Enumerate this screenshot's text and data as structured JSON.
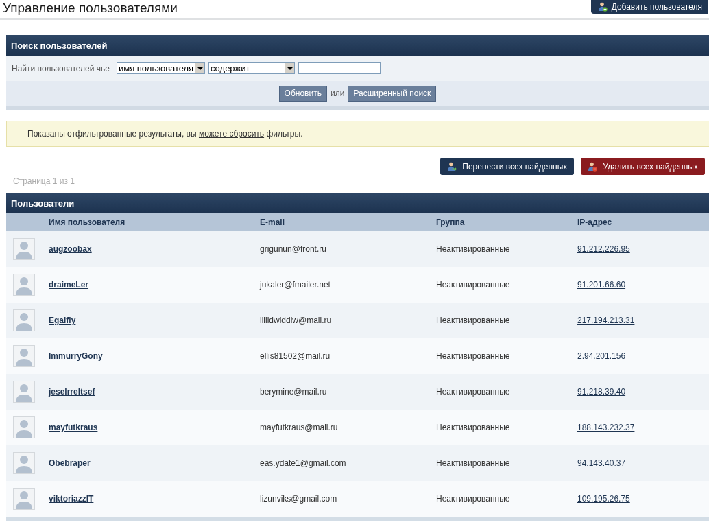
{
  "page_title": "Управление пользователями",
  "add_button": {
    "label": "Добавить пользователя"
  },
  "search_panel": {
    "title": "Поиск пользователей",
    "label": "Найти пользователей чье",
    "dropdowns": [
      {
        "value": "имя пользователя"
      },
      {
        "value": "содержит"
      }
    ],
    "update_button": "Обновить",
    "or_text": "или",
    "advanced_button": "Расширенный поиск"
  },
  "notice": {
    "text_before": "Показаны отфильтрованные результаты, вы ",
    "link": "можете сбросить",
    "text_after": " фильтры."
  },
  "action_buttons": [
    {
      "kind": "move",
      "label": "Перенести всех найденных"
    },
    {
      "kind": "delete",
      "label": "Удалить всех найденных"
    }
  ],
  "pagination": "Страница 1 из 1",
  "users_panel": {
    "title": "Пользователи",
    "columns": [
      "Имя пользователя",
      "E-mail",
      "Группа",
      "IP-адрес"
    ],
    "rows": [
      {
        "username": "augzoobax",
        "email": "grigunun@front.ru",
        "group": "Неактивированные",
        "ip": "91.212.226.95"
      },
      {
        "username": "draimeLer",
        "email": "jukaler@fmailer.net",
        "group": "Неактивированные",
        "ip": "91.201.66.60"
      },
      {
        "username": "Egalfly",
        "email": "iiiiidwiddiw@mail.ru",
        "group": "Неактивированные",
        "ip": "217.194.213.31"
      },
      {
        "username": "ImmurryGony",
        "email": "ellis81502@mail.ru",
        "group": "Неактивированные",
        "ip": "2.94.201.156"
      },
      {
        "username": "jeselrreltsef",
        "email": "berymine@mail.ru",
        "group": "Неактивированные",
        "ip": "91.218.39.40"
      },
      {
        "username": "mayfutkraus",
        "email": "mayfutkraus@mail.ru",
        "group": "Неактивированные",
        "ip": "188.143.232.37"
      },
      {
        "username": "Obebraper",
        "email": "eas.ydate1@gmail.com",
        "group": "Неактивированные",
        "ip": "94.143.40.37"
      },
      {
        "username": "viktoriazzIT",
        "email": "lizunviks@gmail.com",
        "group": "Неактивированные",
        "ip": "109.195.26.75"
      }
    ]
  }
}
